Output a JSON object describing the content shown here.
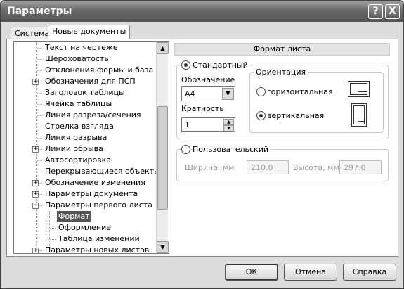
{
  "window": {
    "title": "Параметры",
    "help_glyph": "?",
    "close_glyph": "X"
  },
  "tabs": [
    {
      "label": "Система"
    },
    {
      "label": "Новые документы"
    }
  ],
  "tree": {
    "items": [
      {
        "label": "Текст на чертеже",
        "expandable": false,
        "level": 0
      },
      {
        "label": "Шероховатость",
        "expandable": false,
        "level": 0
      },
      {
        "label": "Отклонения формы и база",
        "expandable": false,
        "level": 0
      },
      {
        "label": "Обозначения для ПСП",
        "expandable": true,
        "level": 0
      },
      {
        "label": "Заголовок таблицы",
        "expandable": false,
        "level": 0
      },
      {
        "label": "Ячейка таблицы",
        "expandable": false,
        "level": 0
      },
      {
        "label": "Линия разреза/сечения",
        "expandable": false,
        "level": 0
      },
      {
        "label": "Стрелка взгляда",
        "expandable": false,
        "level": 0
      },
      {
        "label": "Линия разрыва",
        "expandable": false,
        "level": 0
      },
      {
        "label": "Линии обрыва",
        "expandable": true,
        "level": 0
      },
      {
        "label": "Автосортировка",
        "expandable": false,
        "level": 0
      },
      {
        "label": "Перекрывающиеся объекты",
        "expandable": false,
        "level": 0
      },
      {
        "label": "Обозначение изменения",
        "expandable": true,
        "level": 0
      },
      {
        "label": "Параметры документа",
        "expandable": true,
        "level": 0
      },
      {
        "label": "Параметры первого листа",
        "expandable": true,
        "expanded": true,
        "level": 0
      },
      {
        "label": "Формат",
        "expandable": false,
        "level": 1,
        "selected": true
      },
      {
        "label": "Оформление",
        "expandable": false,
        "level": 1
      },
      {
        "label": "Таблица изменений",
        "expandable": false,
        "level": 1
      },
      {
        "label": "Параметры новых листов",
        "expandable": true,
        "level": 0
      }
    ],
    "expander_plus": "+",
    "expander_minus": "−",
    "scroll_position": 0.62
  },
  "panel": {
    "title": "Формат листа",
    "standard_label": "Стандартный",
    "designation_label": "Обозначение",
    "designation_value": "А4",
    "multiplicity_label": "Кратность",
    "multiplicity_value": "1",
    "orientation_label": "Ориентация",
    "horizontal_label": "горизонтальная",
    "vertical_label": "вертикальная",
    "custom_label": "Пользовательский",
    "width_label": "Ширина, мм",
    "width_value": "210.0",
    "height_label": "Высота, мм",
    "height_value": "297.0"
  },
  "buttons": {
    "ok": "ОК",
    "cancel": "Отмена",
    "help": "Справка"
  }
}
